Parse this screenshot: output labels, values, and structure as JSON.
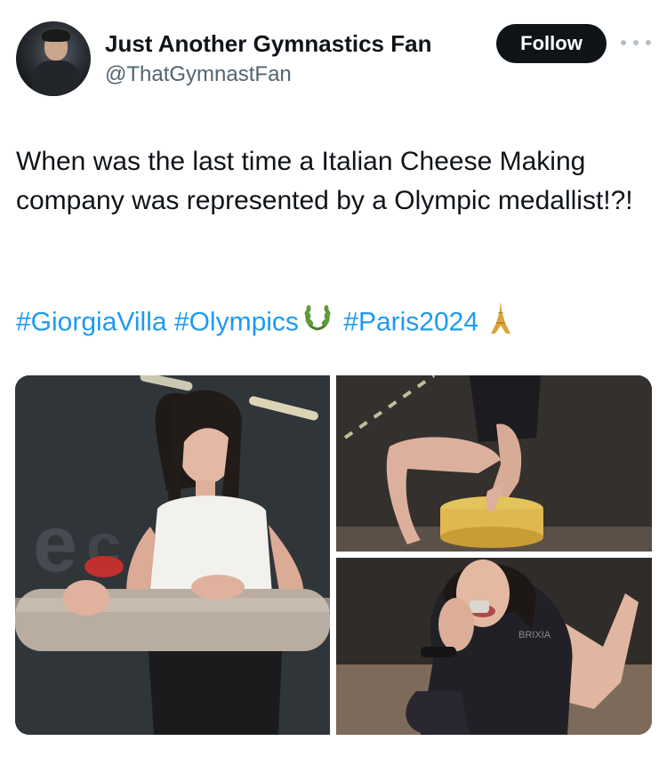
{
  "author": {
    "name": "Just Another Gymnastics Fan",
    "handle": "@ThatGymnastFan"
  },
  "actions": {
    "follow_label": "Follow",
    "more_icon": "more-horizontal-icon"
  },
  "tweet": {
    "text": "When was the last time a Italian Cheese Making company was represented by a Olympic medallist!?!",
    "hashtags": [
      "#GiorgiaVilla",
      "#Olympics",
      "#Paris2024"
    ],
    "emojis": [
      "laurel-wreath-icon",
      "eiffel-tower-icon"
    ]
  },
  "media": {
    "photo_count": 3,
    "brand_text": "BRIXIA"
  },
  "colors": {
    "link": "#1d9bf0",
    "follow_bg": "#0f1419",
    "handle": "#536471"
  }
}
